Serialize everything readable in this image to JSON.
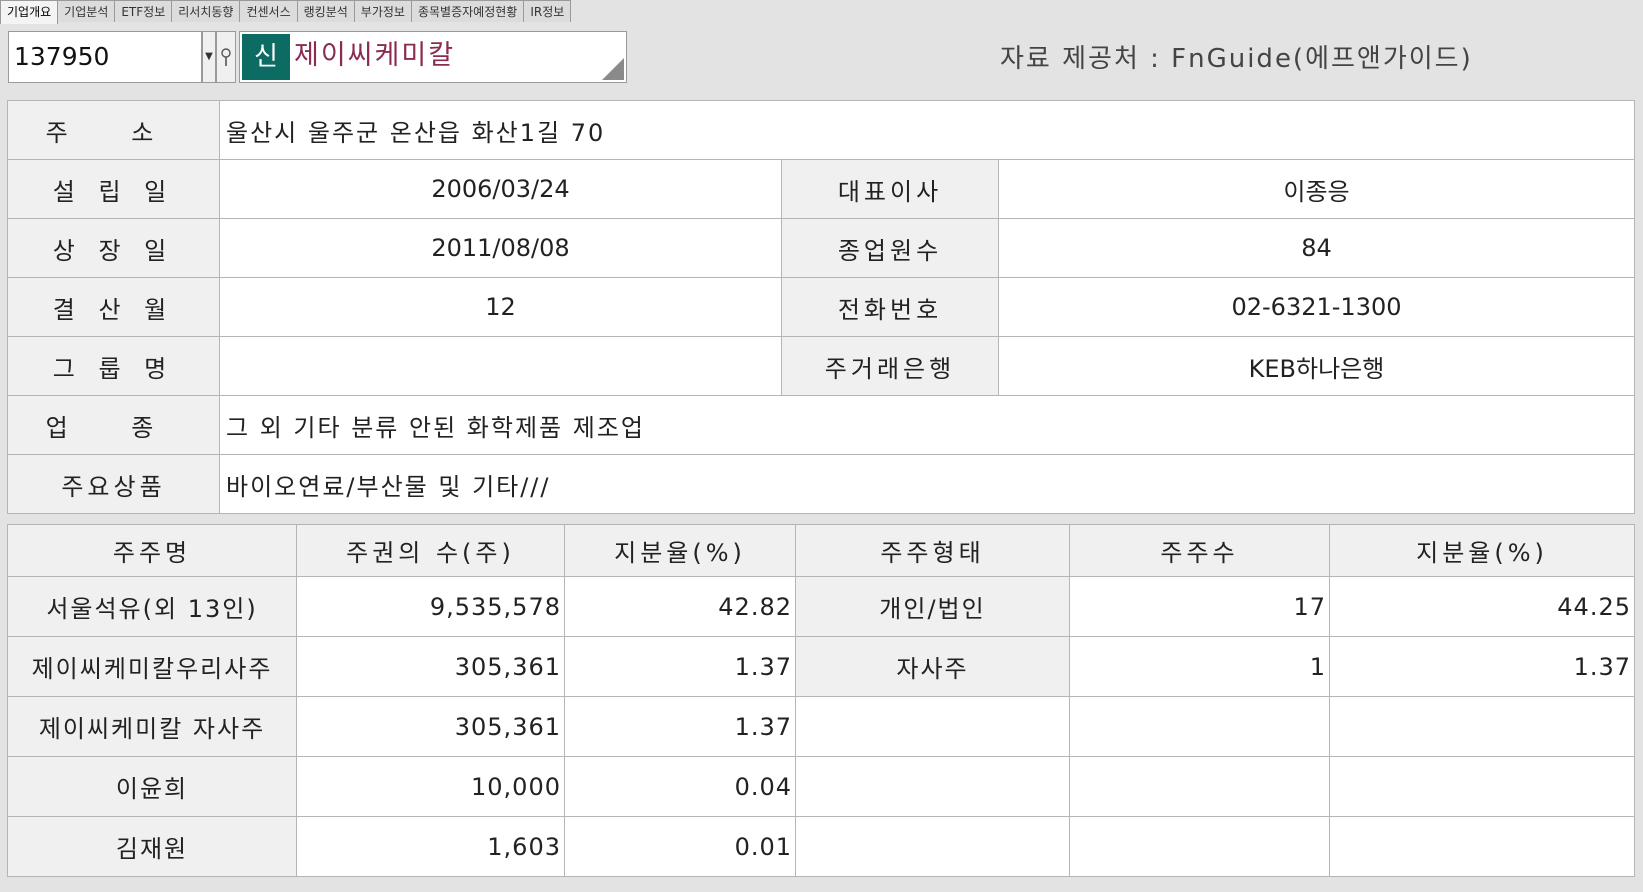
{
  "tabs": [
    {
      "label": "기업개요"
    },
    {
      "label": "기업분석"
    },
    {
      "label": "ETF정보"
    },
    {
      "label": "리서치동향"
    },
    {
      "label": "컨센서스"
    },
    {
      "label": "랭킹분석"
    },
    {
      "label": "부가정보"
    },
    {
      "label": "종목별증자예정현황"
    },
    {
      "label": "IR정보"
    }
  ],
  "toolbar": {
    "code": "137950",
    "badge": "신",
    "company_name": "제이씨케미칼",
    "provider": "자료 제공처 : FnGuide(에프앤가이드)"
  },
  "info": {
    "address_label": "주  소",
    "address": "울산시 울주군 온산읍 화산1길 70",
    "founded_label": "설 립 일",
    "founded": "2006/03/24",
    "ceo_label": "대표이사",
    "ceo": "이종응",
    "listed_label": "상 장 일",
    "listed": "2011/08/08",
    "employees_label": "종업원수",
    "employees": "84",
    "fiscal_label": "결 산 월",
    "fiscal": "12",
    "phone_label": "전화번호",
    "phone": "02-6321-1300",
    "group_label": "그 룹 명",
    "group": "",
    "bank_label": "주거래은행",
    "bank": "KEB하나은행",
    "industry_label": "업  종",
    "industry": "그 외 기타 분류 안된 화학제품 제조업",
    "products_label": "주요상품",
    "products": "바이오연료/부산물 및 기타///"
  },
  "shareholders": {
    "headers": [
      "주주명",
      "주권의 수(주)",
      "지분율(%)",
      "주주형태",
      "주주수",
      "지분율(%)"
    ],
    "rows": [
      {
        "name": "서울석유(외 13인)",
        "shares": "9,535,578",
        "pct": "42.82",
        "type": "개인/법인",
        "count": "17",
        "type_pct": "44.25"
      },
      {
        "name": "제이씨케미칼우리사주",
        "shares": "305,361",
        "pct": "1.37",
        "type": "자사주",
        "count": "1",
        "type_pct": "1.37"
      },
      {
        "name": "제이씨케미칼 자사주",
        "shares": "305,361",
        "pct": "1.37",
        "type": "",
        "count": "",
        "type_pct": ""
      },
      {
        "name": "이윤희",
        "shares": "10,000",
        "pct": "0.04",
        "type": "",
        "count": "",
        "type_pct": ""
      },
      {
        "name": "김재원",
        "shares": "1,603",
        "pct": "0.01",
        "type": "",
        "count": "",
        "type_pct": ""
      }
    ]
  }
}
